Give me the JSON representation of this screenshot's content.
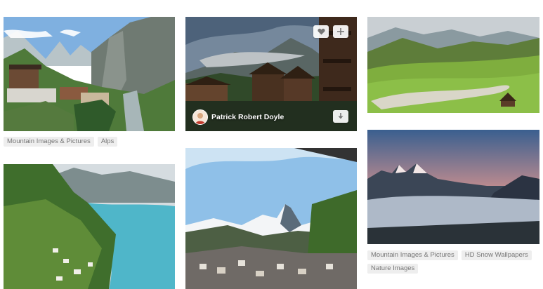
{
  "cards": [
    {
      "id": "lauterbrunnen",
      "tags": [
        "Mountain Images & Pictures",
        "Alps"
      ]
    },
    {
      "id": "chalets",
      "author": "Patrick Robert Doyle",
      "actions": {
        "like": "heart-icon",
        "collect": "plus-icon",
        "download": "download-icon"
      }
    },
    {
      "id": "green-valley"
    },
    {
      "id": "lake-aerial"
    },
    {
      "id": "matterhorn"
    },
    {
      "id": "sunset-fog",
      "tags": [
        "Mountain Images & Pictures",
        "HD Snow Wallpapers",
        "Nature Images"
      ]
    }
  ]
}
